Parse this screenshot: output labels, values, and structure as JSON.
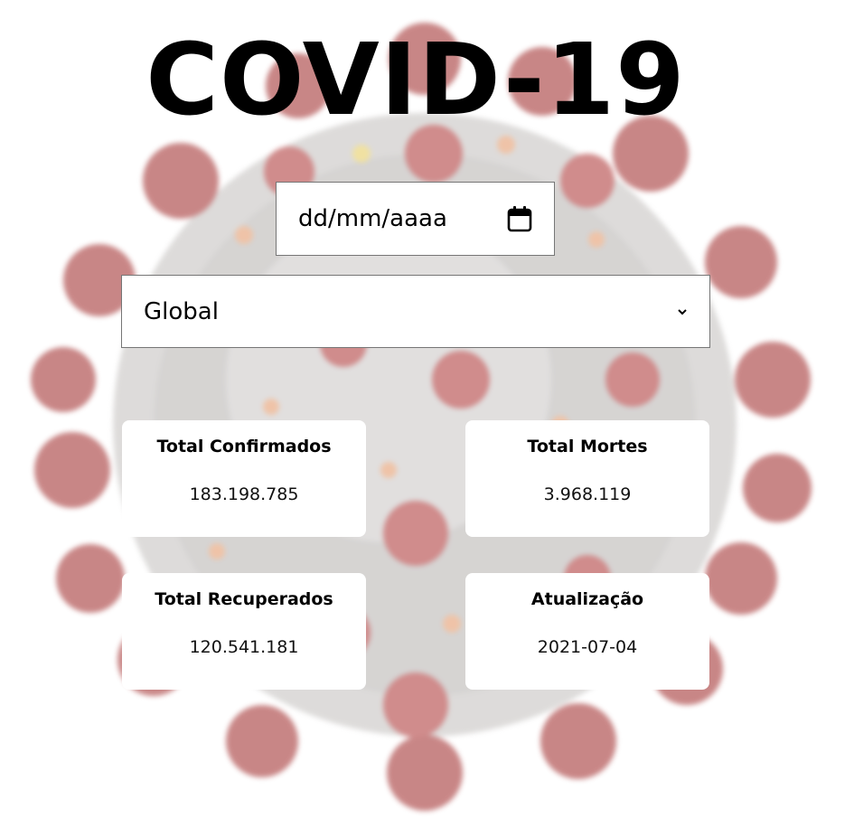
{
  "header": {
    "title": "COVID-19"
  },
  "filters": {
    "date_placeholder": "dd/mm/aaaa",
    "region_selected": "Global"
  },
  "stats": {
    "confirmed": {
      "label": "Total Confirmados",
      "value": "183.198.785"
    },
    "deaths": {
      "label": "Total Mortes",
      "value": "3.968.119"
    },
    "recovered": {
      "label": "Total Recuperados",
      "value": "120.541.181"
    },
    "updated": {
      "label": "Atualização",
      "value": "2021-07-04"
    }
  },
  "icons": {
    "calendar": "calendar-icon",
    "select_arrow": "chevron-down-icon",
    "background": "coronavirus-illustration"
  },
  "colors": {
    "virus_body": "#b9b7b6",
    "virus_spike": "#a23a3a",
    "virus_accent": "#e39a6a",
    "card_bg": "#ffffff",
    "text": "#000000"
  }
}
